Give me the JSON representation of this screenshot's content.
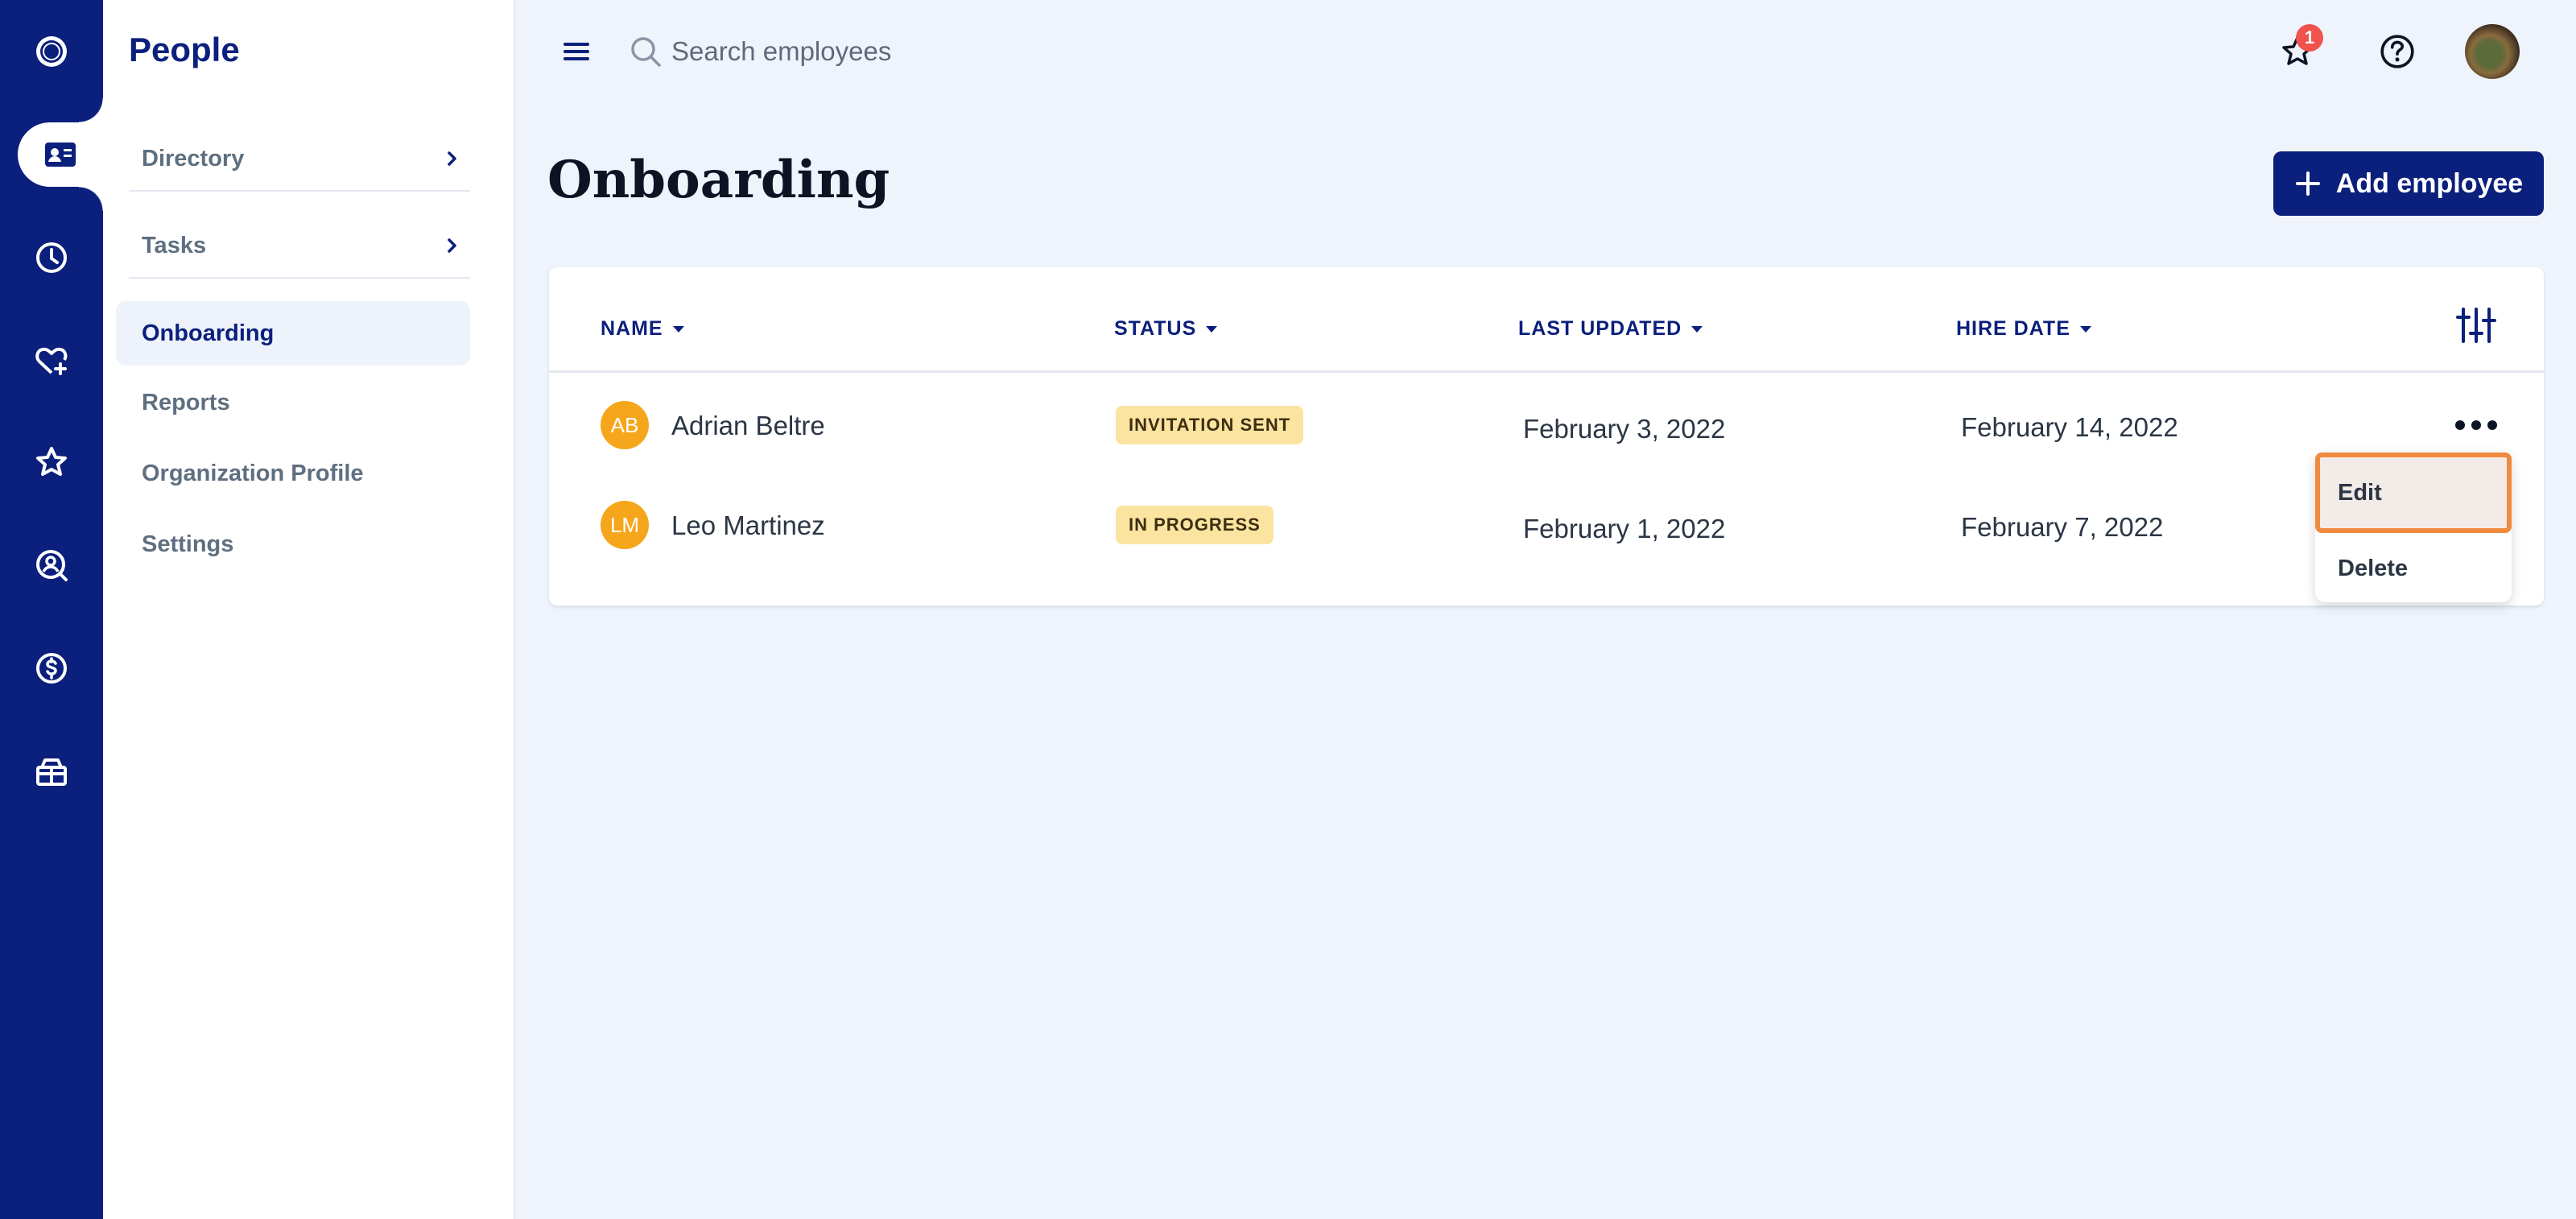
{
  "app": {
    "section_title": "People"
  },
  "sidebar": {
    "items": [
      {
        "label": "Directory"
      },
      {
        "label": "Tasks"
      },
      {
        "label": "Onboarding"
      },
      {
        "label": "Reports"
      },
      {
        "label": "Organization Profile"
      },
      {
        "label": "Settings"
      }
    ]
  },
  "topbar": {
    "search_placeholder": "Search employees",
    "notification_count": "1"
  },
  "page": {
    "title": "Onboarding",
    "add_button_label": "Add employee"
  },
  "table": {
    "columns": [
      "NAME",
      "STATUS",
      "LAST UPDATED",
      "HIRE DATE"
    ],
    "rows": [
      {
        "initials": "AB",
        "name": "Adrian Beltre",
        "status": "INVITATION SENT",
        "last_updated": "February 3, 2022",
        "hire_date": "February 14, 2022"
      },
      {
        "initials": "LM",
        "name": "Leo Martinez",
        "status": "IN PROGRESS",
        "last_updated": "February 1, 2022",
        "hire_date": "February 7, 2022"
      }
    ]
  },
  "context_menu": {
    "items": [
      {
        "label": "Edit"
      },
      {
        "label": "Delete"
      }
    ]
  },
  "colors": {
    "brand": "#0b1f7c",
    "background": "#eff3fb",
    "status_badge": "#fbe3a0",
    "avatar_initials": "#f5a61b",
    "notification": "#f0524e",
    "menu_focus": "#f08a3e"
  },
  "icons": {
    "rail": [
      "logo-icon",
      "people-card-icon",
      "clock-icon",
      "heart-plus-icon",
      "star-icon",
      "person-search-icon",
      "dollar-icon",
      "gift-icon"
    ]
  }
}
